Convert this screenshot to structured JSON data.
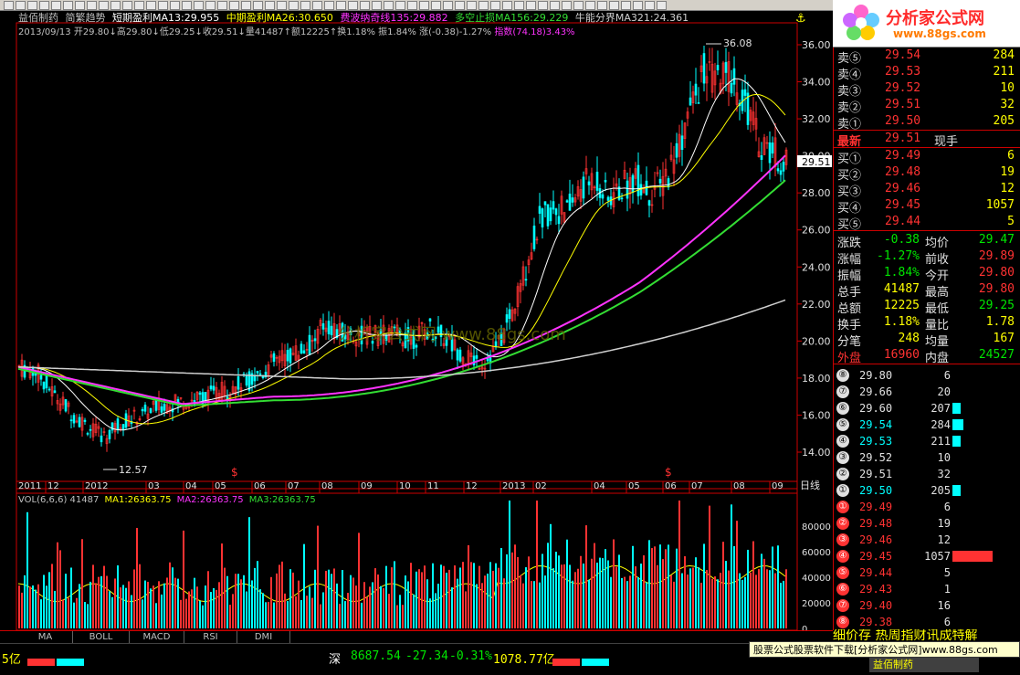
{
  "toolbar": {
    "button_count": 56
  },
  "header": {
    "stock_name": "益佰制药",
    "indicator_name": "简繁趋势",
    "ma13": "短期盈利MA13:29.955",
    "ma26": "中期盈利MA26:30.650",
    "ma135": "费波纳奇线135:29.882",
    "ma156": "多空止损MA156:29.229",
    "ma321": "牛能分界MA321:24.361",
    "line2": "2013/09/13  开29.80↓高29.80↓低29.25↓收29.51↓量41487↑额12225↑换1.18%  振1.84%  涨(-0.38)-1.27%  ",
    "index_label": "指数(74.18)3.43%"
  },
  "chart_labels": {
    "high_label": "36.08",
    "low_label": "12.57",
    "current_price": "29.51",
    "watermark": "分析家公式网 www.88gs.com",
    "period_label": "日线",
    "dividend_marks": [
      "$",
      "$"
    ]
  },
  "price_axis": [
    "36.00",
    "34.00",
    "32.00",
    "30.00",
    "28.00",
    "26.00",
    "24.00",
    "22.00",
    "20.00",
    "18.00",
    "16.00",
    "14.00"
  ],
  "time_axis": [
    "2011",
    "12",
    "2012",
    "03",
    "04",
    "05",
    "06",
    "07",
    "08",
    "09",
    "10",
    "11",
    "12",
    "2013",
    "02",
    "04",
    "05",
    "06",
    "07",
    "08",
    "09"
  ],
  "volume": {
    "header_vol": "VOL(6,6,6)  41487",
    "ma1": "MA1:26363.75",
    "ma2": "MA2:26363.75",
    "ma3": "MA3:26363.75",
    "axis": [
      "80000",
      "60000",
      "40000",
      "20000",
      "0"
    ]
  },
  "quotes": {
    "asks": [
      {
        "label": "卖⑤",
        "price": "29.54",
        "vol": "284"
      },
      {
        "label": "卖④",
        "price": "29.53",
        "vol": "211"
      },
      {
        "label": "卖③",
        "price": "29.52",
        "vol": "10"
      },
      {
        "label": "卖②",
        "price": "29.51",
        "vol": "32"
      },
      {
        "label": "卖①",
        "price": "29.50",
        "vol": "205"
      }
    ],
    "latest": {
      "label": "最新",
      "price": "29.51",
      "extra": "现手"
    },
    "bids": [
      {
        "label": "买①",
        "price": "29.49",
        "vol": "6"
      },
      {
        "label": "买②",
        "price": "29.48",
        "vol": "19"
      },
      {
        "label": "买③",
        "price": "29.46",
        "vol": "12"
      },
      {
        "label": "买④",
        "price": "29.45",
        "vol": "1057"
      },
      {
        "label": "买⑤",
        "price": "29.44",
        "vol": "5"
      }
    ]
  },
  "stats": [
    {
      "l1": "涨跌",
      "v1": "-0.38",
      "l2": "均价",
      "v2": "29.47"
    },
    {
      "l1": "涨幅",
      "v1": "-1.27%",
      "l2": "前收",
      "v2": "29.89"
    },
    {
      "l1": "振幅",
      "v1": "1.84%",
      "l2": "今开",
      "v2": "29.80"
    },
    {
      "l1": "总手",
      "v1": "41487",
      "l2": "最高",
      "v2": "29.80"
    },
    {
      "l1": "总额",
      "v1": "12225",
      "l2": "最低",
      "v2": "29.25"
    },
    {
      "l1": "换手",
      "v1": "1.18%",
      "l2": "量比",
      "v2": "1.78"
    },
    {
      "l1": "分笔",
      "v1": "248",
      "l2": "均量",
      "v2": "167"
    },
    {
      "l1": "外盘",
      "v1": "16960",
      "l2": "内盘",
      "v2": "24527"
    }
  ],
  "ticks": [
    {
      "n": "⑧",
      "price": "29.80",
      "vol": "6",
      "bar": 0,
      "side": "s"
    },
    {
      "n": "⑦",
      "price": "29.66",
      "vol": "20",
      "bar": 0,
      "side": "s"
    },
    {
      "n": "⑥",
      "price": "29.60",
      "vol": "207",
      "bar": 0.2,
      "side": "s"
    },
    {
      "n": "⑤",
      "price": "29.54",
      "vol": "284",
      "bar": 0.27,
      "side": "s"
    },
    {
      "n": "④",
      "price": "29.53",
      "vol": "211",
      "bar": 0.2,
      "side": "s"
    },
    {
      "n": "③",
      "price": "29.52",
      "vol": "10",
      "bar": 0,
      "side": "s"
    },
    {
      "n": "②",
      "price": "29.51",
      "vol": "32",
      "bar": 0,
      "side": "s"
    },
    {
      "n": "①",
      "price": "29.50",
      "vol": "205",
      "bar": 0.2,
      "side": "s"
    },
    {
      "n": "①",
      "price": "29.49",
      "vol": "6",
      "bar": 0,
      "side": "b"
    },
    {
      "n": "②",
      "price": "29.48",
      "vol": "19",
      "bar": 0,
      "side": "b"
    },
    {
      "n": "③",
      "price": "29.46",
      "vol": "12",
      "bar": 0,
      "side": "b"
    },
    {
      "n": "④",
      "price": "29.45",
      "vol": "1057",
      "bar": 1,
      "side": "b"
    },
    {
      "n": "⑤",
      "price": "29.44",
      "vol": "5",
      "bar": 0,
      "side": "b"
    },
    {
      "n": "⑥",
      "price": "29.43",
      "vol": "1",
      "bar": 0,
      "side": "b"
    },
    {
      "n": "⑦",
      "price": "29.40",
      "vol": "16",
      "bar": 0,
      "side": "b"
    },
    {
      "n": "⑧",
      "price": "29.38",
      "vol": "6",
      "bar": 0,
      "side": "b"
    }
  ],
  "tabs": [
    "MA",
    "BOLL",
    "MACD",
    "RSI",
    "DMI"
  ],
  "status": {
    "left_prefix": "5亿",
    "index_name": "深",
    "index_value": "8687.54",
    "index_change": "-27.34",
    "index_pct": "-0.31%",
    "index_amount": "1078.77亿"
  },
  "ticker": "细价存  热周指财讯成特解",
  "ad": "股票公式股票软件下载[分析家公式网]www.88gs.com",
  "stock_tag": "益佰制药",
  "logo": {
    "title": "分析家公式网",
    "url": "www.88gs.com"
  },
  "colors": {
    "red": "#ff3232",
    "green": "#00e600",
    "magenta": "#ff33ff",
    "cyan": "#00ffff",
    "yellow": "#ffff00",
    "ma_green": "#33dd33",
    "ma_white": "#d0d0d0"
  }
}
